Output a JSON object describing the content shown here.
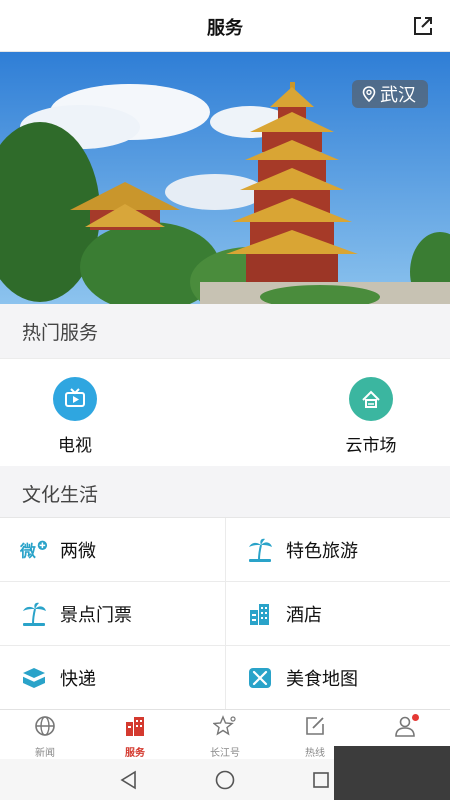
{
  "header": {
    "title": "服务",
    "share_icon": "share-external-icon"
  },
  "hero": {
    "location": "武汉",
    "location_icon": "location-pin-icon"
  },
  "hot_services": {
    "title": "热门服务",
    "items": [
      {
        "label": "电视",
        "icon": "tv-icon",
        "color": "#2fa6e0"
      },
      {
        "label": "云市场",
        "icon": "cloud-market-icon",
        "color": "#3bb6a0"
      }
    ]
  },
  "culture": {
    "title": "文化生活",
    "items": [
      {
        "label": "两微",
        "icon": "weibo-wechat-icon"
      },
      {
        "label": "特色旅游",
        "icon": "palm-tree-icon"
      },
      {
        "label": "景点门票",
        "icon": "palm-tree-icon"
      },
      {
        "label": "酒店",
        "icon": "hotel-building-icon"
      },
      {
        "label": "快递",
        "icon": "express-box-icon"
      },
      {
        "label": "美食地图",
        "icon": "food-map-icon"
      }
    ]
  },
  "tabbar": {
    "tabs": [
      {
        "label": "新闻",
        "icon": "globe-icon",
        "active": false
      },
      {
        "label": "服务",
        "icon": "buildings-icon",
        "active": true
      },
      {
        "label": "长江号",
        "icon": "star-icon",
        "active": false
      },
      {
        "label": "热线",
        "icon": "edit-icon",
        "active": false
      },
      {
        "label": "",
        "icon": "profile-icon",
        "active": false
      }
    ]
  },
  "colors": {
    "accent": "#d43a2f",
    "icon_teal": "#2aa3c9",
    "section_bg": "#f4f4f6"
  },
  "system_nav": {
    "back": "back-triangle-icon",
    "home": "home-circle-icon",
    "recents": "recents-square-icon"
  }
}
